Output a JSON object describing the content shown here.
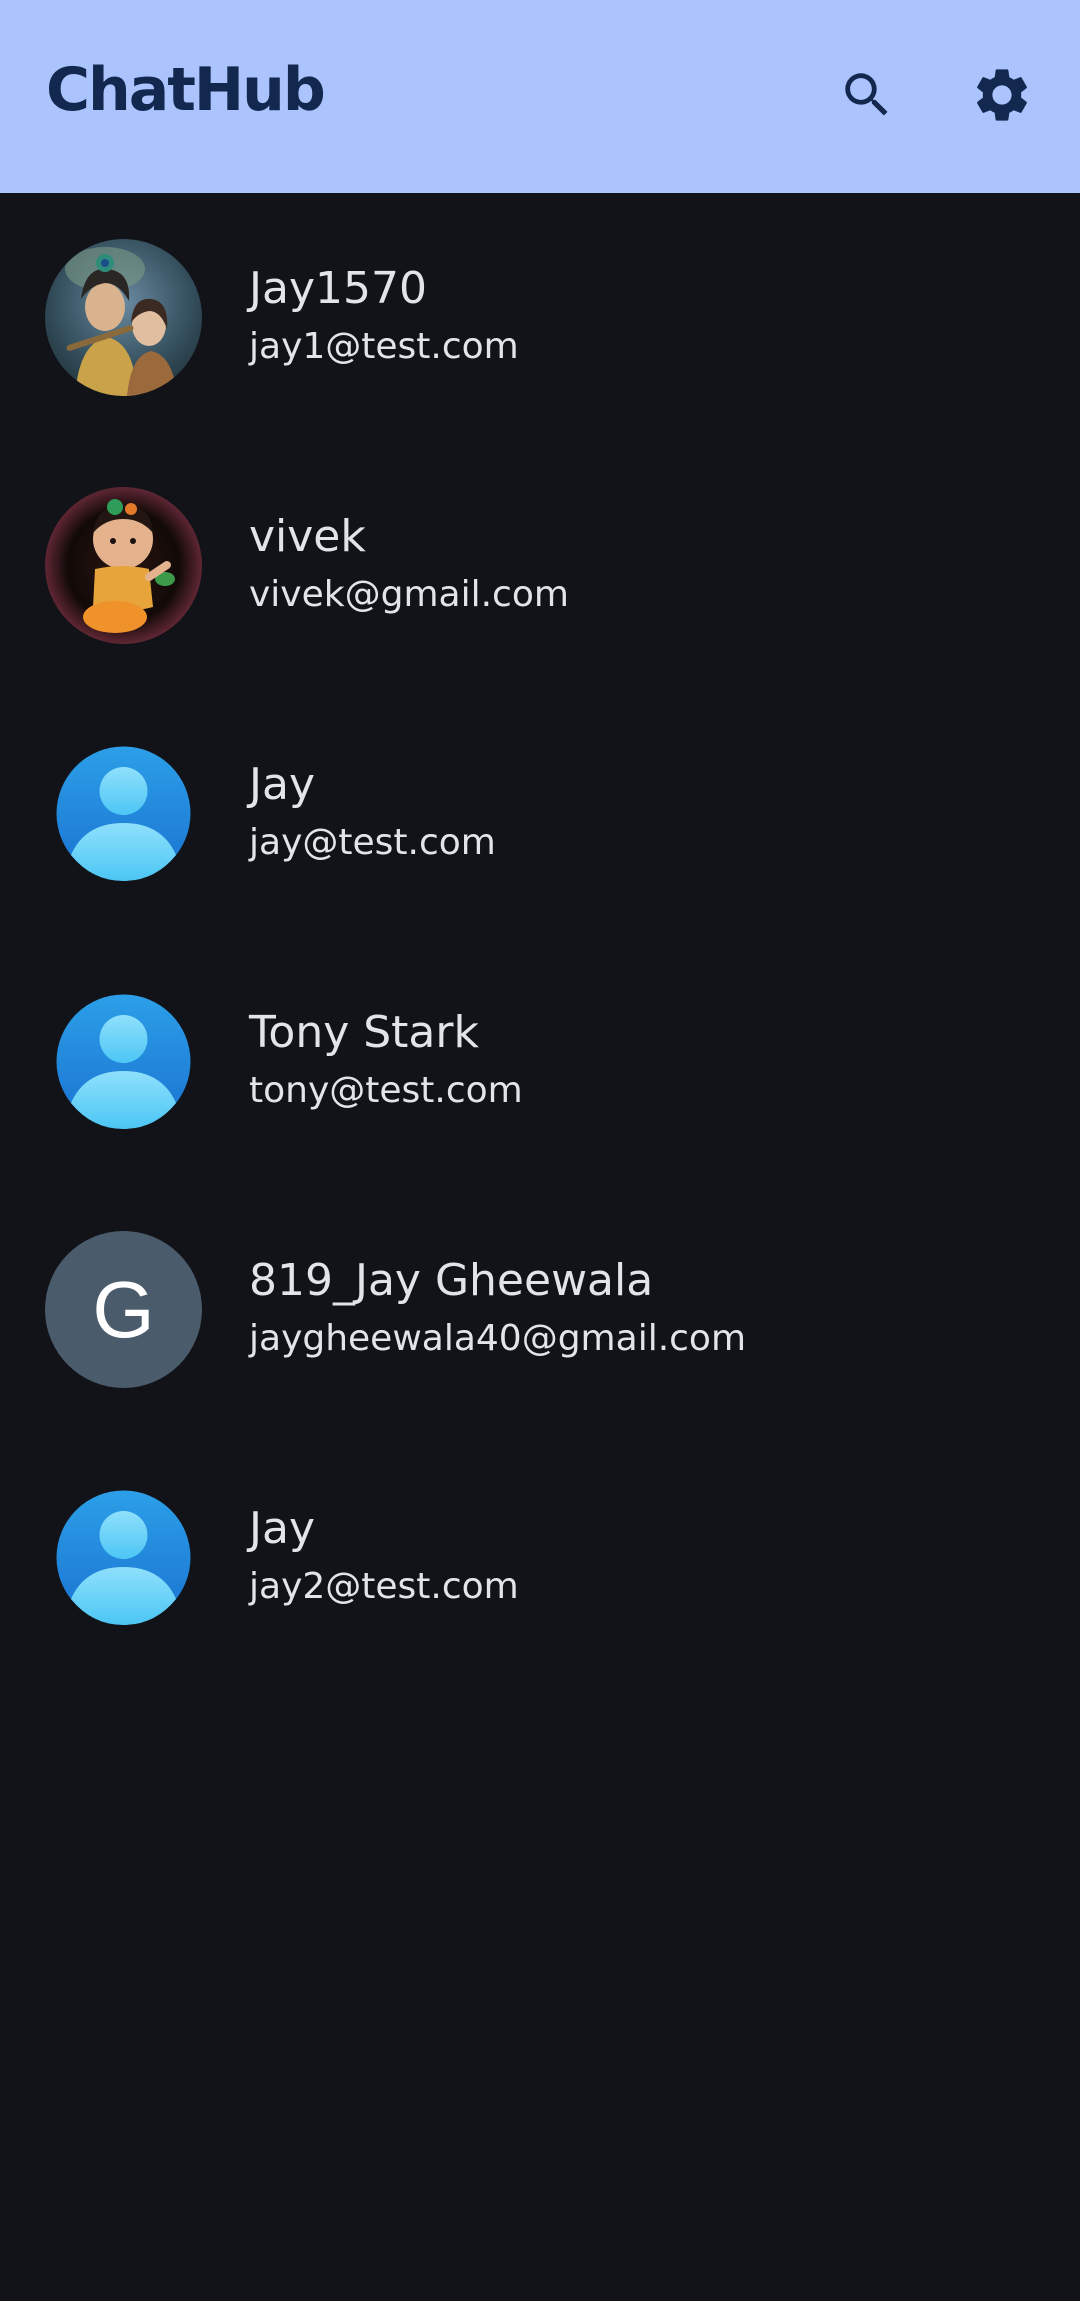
{
  "app": {
    "title": "ChatHub"
  },
  "toolbar": {
    "search_icon": "search-icon",
    "settings_icon": "gear-icon"
  },
  "colors": {
    "app_bar": "#abc4fe",
    "title": "#13284f",
    "background": "#121318",
    "text": "#e3e4ea",
    "letter_avatar": "#4a5c6b"
  },
  "contacts": [
    {
      "name": "Jay1570",
      "email": "jay1@test.com",
      "avatar": "photo-krishna-radha"
    },
    {
      "name": "vivek",
      "email": "vivek@gmail.com",
      "avatar": "photo-baby-krishna"
    },
    {
      "name": "Jay",
      "email": "jay@test.com",
      "avatar": "default-person-icon"
    },
    {
      "name": "Tony Stark",
      "email": "tony@test.com",
      "avatar": "default-person-icon"
    },
    {
      "name": "819_Jay Gheewala",
      "email": "jaygheewala40@gmail.com",
      "avatar": "letter",
      "avatar_letter": "G"
    },
    {
      "name": "Jay",
      "email": "jay2@test.com",
      "avatar": "default-person-icon"
    }
  ]
}
